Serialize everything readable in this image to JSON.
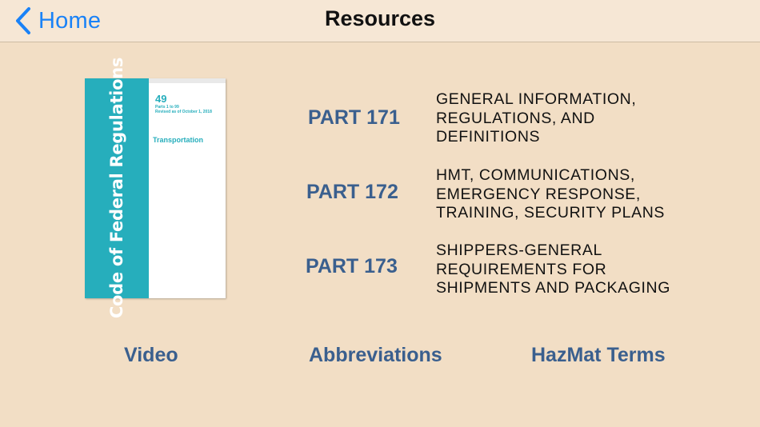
{
  "navbar": {
    "back_label": "Home",
    "title": "Resources",
    "back_icon": "chevron-left-icon"
  },
  "book": {
    "spine_text": "Code of Federal Regulations",
    "title_number": "49",
    "subtitle_line1": "Parts 1 to 99",
    "subtitle_line2": "Revised as of October 1, 2018",
    "cover_label": "Transportation",
    "spine_color": "#26aebc"
  },
  "parts": [
    {
      "label": "PART 171",
      "description": [
        "GENERAL INFORMATION,",
        "REGULATIONS, AND",
        "DEFINITIONS"
      ]
    },
    {
      "label": "PART 172",
      "description": [
        "HMT, COMMUNICATIONS,",
        "EMERGENCY RESPONSE,",
        "TRAINING, SECURITY PLANS"
      ]
    },
    {
      "label": "PART 173",
      "description": [
        "SHIPPERS-GENERAL",
        "REQUIREMENTS FOR",
        "SHIPMENTS AND PACKAGING"
      ]
    }
  ],
  "bottom_links": {
    "video": "Video",
    "abbreviations": "Abbreviations",
    "hazmat_terms": "HazMat Terms"
  },
  "colors": {
    "background": "#f2dec5",
    "navbar": "#f6e7d5",
    "link": "#3a5f8e",
    "back_blue": "#1a82f7"
  }
}
